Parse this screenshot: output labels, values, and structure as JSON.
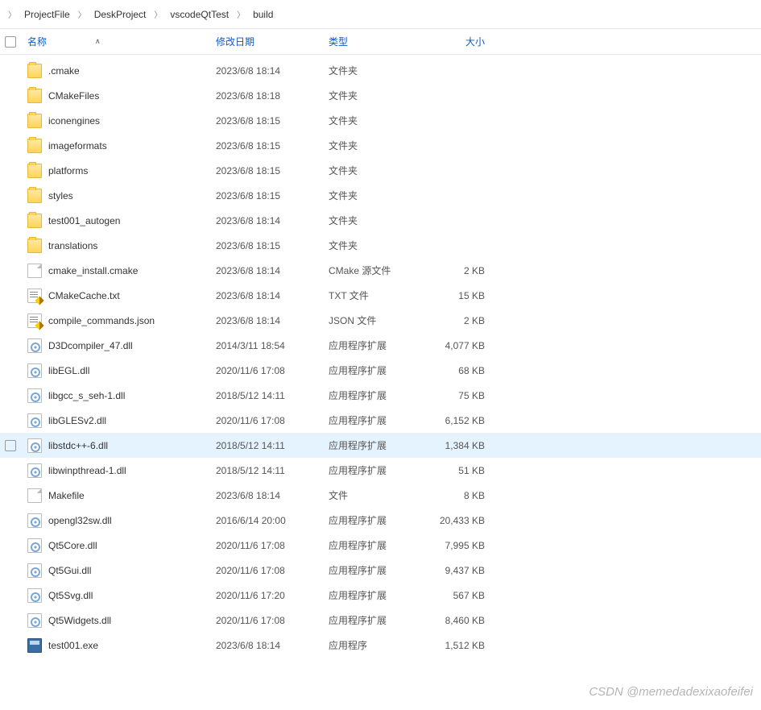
{
  "breadcrumb": [
    "ProjectFile",
    "DeskProject",
    "vscodeQtTest",
    "build"
  ],
  "columns": {
    "name": "名称",
    "date": "修改日期",
    "type": "类型",
    "size": "大小"
  },
  "hovered_index": 17,
  "files": [
    {
      "name": ".cmake",
      "date": "2023/6/8 18:14",
      "type": "文件夹",
      "size": "",
      "icon": "folder"
    },
    {
      "name": "CMakeFiles",
      "date": "2023/6/8 18:18",
      "type": "文件夹",
      "size": "",
      "icon": "folder"
    },
    {
      "name": "iconengines",
      "date": "2023/6/8 18:15",
      "type": "文件夹",
      "size": "",
      "icon": "folder"
    },
    {
      "name": "imageformats",
      "date": "2023/6/8 18:15",
      "type": "文件夹",
      "size": "",
      "icon": "folder"
    },
    {
      "name": "platforms",
      "date": "2023/6/8 18:15",
      "type": "文件夹",
      "size": "",
      "icon": "folder"
    },
    {
      "name": "styles",
      "date": "2023/6/8 18:15",
      "type": "文件夹",
      "size": "",
      "icon": "folder"
    },
    {
      "name": "test001_autogen",
      "date": "2023/6/8 18:14",
      "type": "文件夹",
      "size": "",
      "icon": "folder"
    },
    {
      "name": "translations",
      "date": "2023/6/8 18:15",
      "type": "文件夹",
      "size": "",
      "icon": "folder"
    },
    {
      "name": "cmake_install.cmake",
      "date": "2023/6/8 18:14",
      "type": "CMake 源文件",
      "size": "2 KB",
      "icon": "file"
    },
    {
      "name": "CMakeCache.txt",
      "date": "2023/6/8 18:14",
      "type": "TXT 文件",
      "size": "15 KB",
      "icon": "txt"
    },
    {
      "name": "compile_commands.json",
      "date": "2023/6/8 18:14",
      "type": "JSON 文件",
      "size": "2 KB",
      "icon": "txt"
    },
    {
      "name": "D3Dcompiler_47.dll",
      "date": "2014/3/11 18:54",
      "type": "应用程序扩展",
      "size": "4,077 KB",
      "icon": "dll"
    },
    {
      "name": "libEGL.dll",
      "date": "2020/11/6 17:08",
      "type": "应用程序扩展",
      "size": "68 KB",
      "icon": "dll"
    },
    {
      "name": "libgcc_s_seh-1.dll",
      "date": "2018/5/12 14:11",
      "type": "应用程序扩展",
      "size": "75 KB",
      "icon": "dll"
    },
    {
      "name": "libGLESv2.dll",
      "date": "2020/11/6 17:08",
      "type": "应用程序扩展",
      "size": "6,152 KB",
      "icon": "dll"
    },
    {
      "name": "libstdc++-6.dll",
      "date": "2018/5/12 14:11",
      "type": "应用程序扩展",
      "size": "1,384 KB",
      "icon": "dll"
    },
    {
      "name": "libwinpthread-1.dll",
      "date": "2018/5/12 14:11",
      "type": "应用程序扩展",
      "size": "51 KB",
      "icon": "dll"
    },
    {
      "name": "Makefile",
      "date": "2023/6/8 18:14",
      "type": "文件",
      "size": "8 KB",
      "icon": "file"
    },
    {
      "name": "opengl32sw.dll",
      "date": "2016/6/14 20:00",
      "type": "应用程序扩展",
      "size": "20,433 KB",
      "icon": "dll"
    },
    {
      "name": "Qt5Core.dll",
      "date": "2020/11/6 17:08",
      "type": "应用程序扩展",
      "size": "7,995 KB",
      "icon": "dll"
    },
    {
      "name": "Qt5Gui.dll",
      "date": "2020/11/6 17:08",
      "type": "应用程序扩展",
      "size": "9,437 KB",
      "icon": "dll"
    },
    {
      "name": "Qt5Svg.dll",
      "date": "2020/11/6 17:20",
      "type": "应用程序扩展",
      "size": "567 KB",
      "icon": "dll"
    },
    {
      "name": "Qt5Widgets.dll",
      "date": "2020/11/6 17:08",
      "type": "应用程序扩展",
      "size": "8,460 KB",
      "icon": "dll"
    },
    {
      "name": "test001.exe",
      "date": "2023/6/8 18:14",
      "type": "应用程序",
      "size": "1,512 KB",
      "icon": "exe"
    }
  ],
  "watermark": "CSDN @memedadexixaofeifei"
}
